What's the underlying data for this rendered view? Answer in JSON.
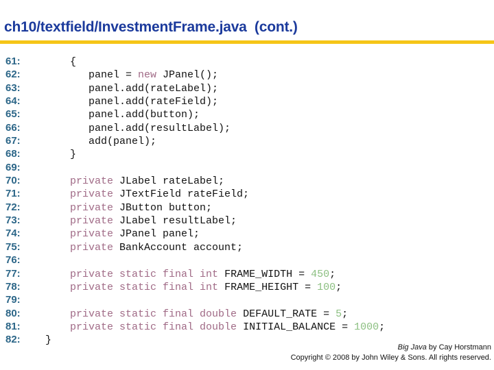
{
  "title": "ch10/textfield/InvestmentFrame.java  (cont.)",
  "colors": {
    "title": "#1b3a9c",
    "rule": "#f5c518",
    "line_number": "#2c6688",
    "keyword": "#a06a86",
    "number": "#8bbf80",
    "text": "#111111"
  },
  "code_lines": [
    {
      "n": "61:",
      "tokens": [
        {
          "t": "      {",
          "c": ""
        }
      ]
    },
    {
      "n": "62:",
      "tokens": [
        {
          "t": "         panel = ",
          "c": ""
        },
        {
          "t": "new",
          "c": "kw"
        },
        {
          "t": " JPanel();",
          "c": ""
        }
      ]
    },
    {
      "n": "63:",
      "tokens": [
        {
          "t": "         panel.add(rateLabel);",
          "c": ""
        }
      ]
    },
    {
      "n": "64:",
      "tokens": [
        {
          "t": "         panel.add(rateField);",
          "c": ""
        }
      ]
    },
    {
      "n": "65:",
      "tokens": [
        {
          "t": "         panel.add(button);",
          "c": ""
        }
      ]
    },
    {
      "n": "66:",
      "tokens": [
        {
          "t": "         panel.add(resultLabel);",
          "c": ""
        }
      ]
    },
    {
      "n": "67:",
      "tokens": [
        {
          "t": "         add(panel);",
          "c": ""
        }
      ]
    },
    {
      "n": "68:",
      "tokens": [
        {
          "t": "      }",
          "c": ""
        }
      ]
    },
    {
      "n": "69:",
      "tokens": []
    },
    {
      "n": "70:",
      "tokens": [
        {
          "t": "      ",
          "c": ""
        },
        {
          "t": "private",
          "c": "kw"
        },
        {
          "t": " JLabel rateLabel;",
          "c": ""
        }
      ]
    },
    {
      "n": "71:",
      "tokens": [
        {
          "t": "      ",
          "c": ""
        },
        {
          "t": "private",
          "c": "kw"
        },
        {
          "t": " JTextField rateField;",
          "c": ""
        }
      ]
    },
    {
      "n": "72:",
      "tokens": [
        {
          "t": "      ",
          "c": ""
        },
        {
          "t": "private",
          "c": "kw"
        },
        {
          "t": " JButton button;",
          "c": ""
        }
      ]
    },
    {
      "n": "73:",
      "tokens": [
        {
          "t": "      ",
          "c": ""
        },
        {
          "t": "private",
          "c": "kw"
        },
        {
          "t": " JLabel resultLabel;",
          "c": ""
        }
      ]
    },
    {
      "n": "74:",
      "tokens": [
        {
          "t": "      ",
          "c": ""
        },
        {
          "t": "private",
          "c": "kw"
        },
        {
          "t": " JPanel panel;",
          "c": ""
        }
      ]
    },
    {
      "n": "75:",
      "tokens": [
        {
          "t": "      ",
          "c": ""
        },
        {
          "t": "private",
          "c": "kw"
        },
        {
          "t": " BankAccount account;",
          "c": ""
        }
      ]
    },
    {
      "n": "76:",
      "tokens": []
    },
    {
      "n": "77:",
      "tokens": [
        {
          "t": "      ",
          "c": ""
        },
        {
          "t": "private static final int",
          "c": "kw"
        },
        {
          "t": " FRAME_WIDTH = ",
          "c": ""
        },
        {
          "t": "450",
          "c": "num"
        },
        {
          "t": ";",
          "c": ""
        }
      ]
    },
    {
      "n": "78:",
      "tokens": [
        {
          "t": "      ",
          "c": ""
        },
        {
          "t": "private static final int",
          "c": "kw"
        },
        {
          "t": " FRAME_HEIGHT = ",
          "c": ""
        },
        {
          "t": "100",
          "c": "num"
        },
        {
          "t": ";",
          "c": ""
        }
      ]
    },
    {
      "n": "79:",
      "tokens": []
    },
    {
      "n": "80:",
      "tokens": [
        {
          "t": "      ",
          "c": ""
        },
        {
          "t": "private static final double",
          "c": "kw"
        },
        {
          "t": " DEFAULT_RATE = ",
          "c": ""
        },
        {
          "t": "5",
          "c": "num"
        },
        {
          "t": ";",
          "c": ""
        }
      ]
    },
    {
      "n": "81:",
      "tokens": [
        {
          "t": "      ",
          "c": ""
        },
        {
          "t": "private static final double",
          "c": "kw"
        },
        {
          "t": " INITIAL_BALANCE = ",
          "c": ""
        },
        {
          "t": "1000",
          "c": "num"
        },
        {
          "t": ";",
          "c": ""
        }
      ]
    },
    {
      "n": "82:",
      "tokens": [
        {
          "t": "  }",
          "c": ""
        }
      ]
    }
  ],
  "footer": {
    "book_title": "Big Java",
    "byline": " by Cay Horstmann",
    "copyright": "Copyright © 2008 by John Wiley & Sons.  All rights reserved."
  }
}
